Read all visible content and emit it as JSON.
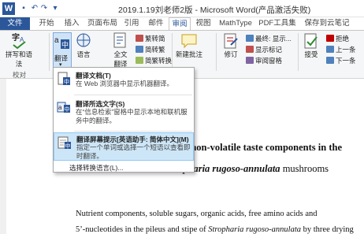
{
  "window": {
    "title": "2019.1.19刘老师2版 - Microsoft Word(产品激活失败)"
  },
  "tabs": {
    "file": "文件",
    "items": [
      "开始",
      "插入",
      "页面布局",
      "引用",
      "邮件",
      "审阅",
      "视图",
      "MathType",
      "PDF工具集",
      "保存到云笔记"
    ],
    "active": "审阅"
  },
  "ribbon": {
    "spelling": "拼写和语法",
    "proofing_group": "校对",
    "translate": "翻译",
    "language": "语言",
    "fulltext_1": "全文",
    "fulltext_2": "翻译",
    "chinese_items": [
      "繁转简",
      "简转繁",
      "简繁转换"
    ],
    "new_comment": "新建批注",
    "track": "修订",
    "markup_items": [
      "最终: 显示...",
      "显示标记",
      "审阅窗格"
    ],
    "accept": "接受",
    "change_items": [
      "拒绝",
      "上一条",
      "下一条"
    ]
  },
  "menu": {
    "items": [
      {
        "title": "翻译文档(T)",
        "desc": "在 Web 浏览器中显示机器翻译。"
      },
      {
        "title": "翻译所选文字(S)",
        "desc": "在“信息检索”窗格中显示本地和联机服务中的翻译。"
      },
      {
        "title": "翻译屏幕提示[英语助手: 简体中文](M)",
        "desc": "指定一个单词或选择一个短语以查看即时翻译。"
      }
    ],
    "choose_lang": "选择转换语言(L)..."
  },
  "document": {
    "line1": "on non-volatile taste components in the",
    "line2_italic": "opharia rugoso-annulata",
    "line2_rest": " mushrooms",
    "para1": "Nutrient components, soluble sugars, organic acids, free amino acids and",
    "para2_start": "5’-nucleotides in the pileus and stipe of ",
    "para2_italic": "Stropharia rugoso-annulata",
    "para2_end": " by three drying"
  },
  "colors": {
    "brand": "#2b579a",
    "highlight": "#cde6f7"
  }
}
